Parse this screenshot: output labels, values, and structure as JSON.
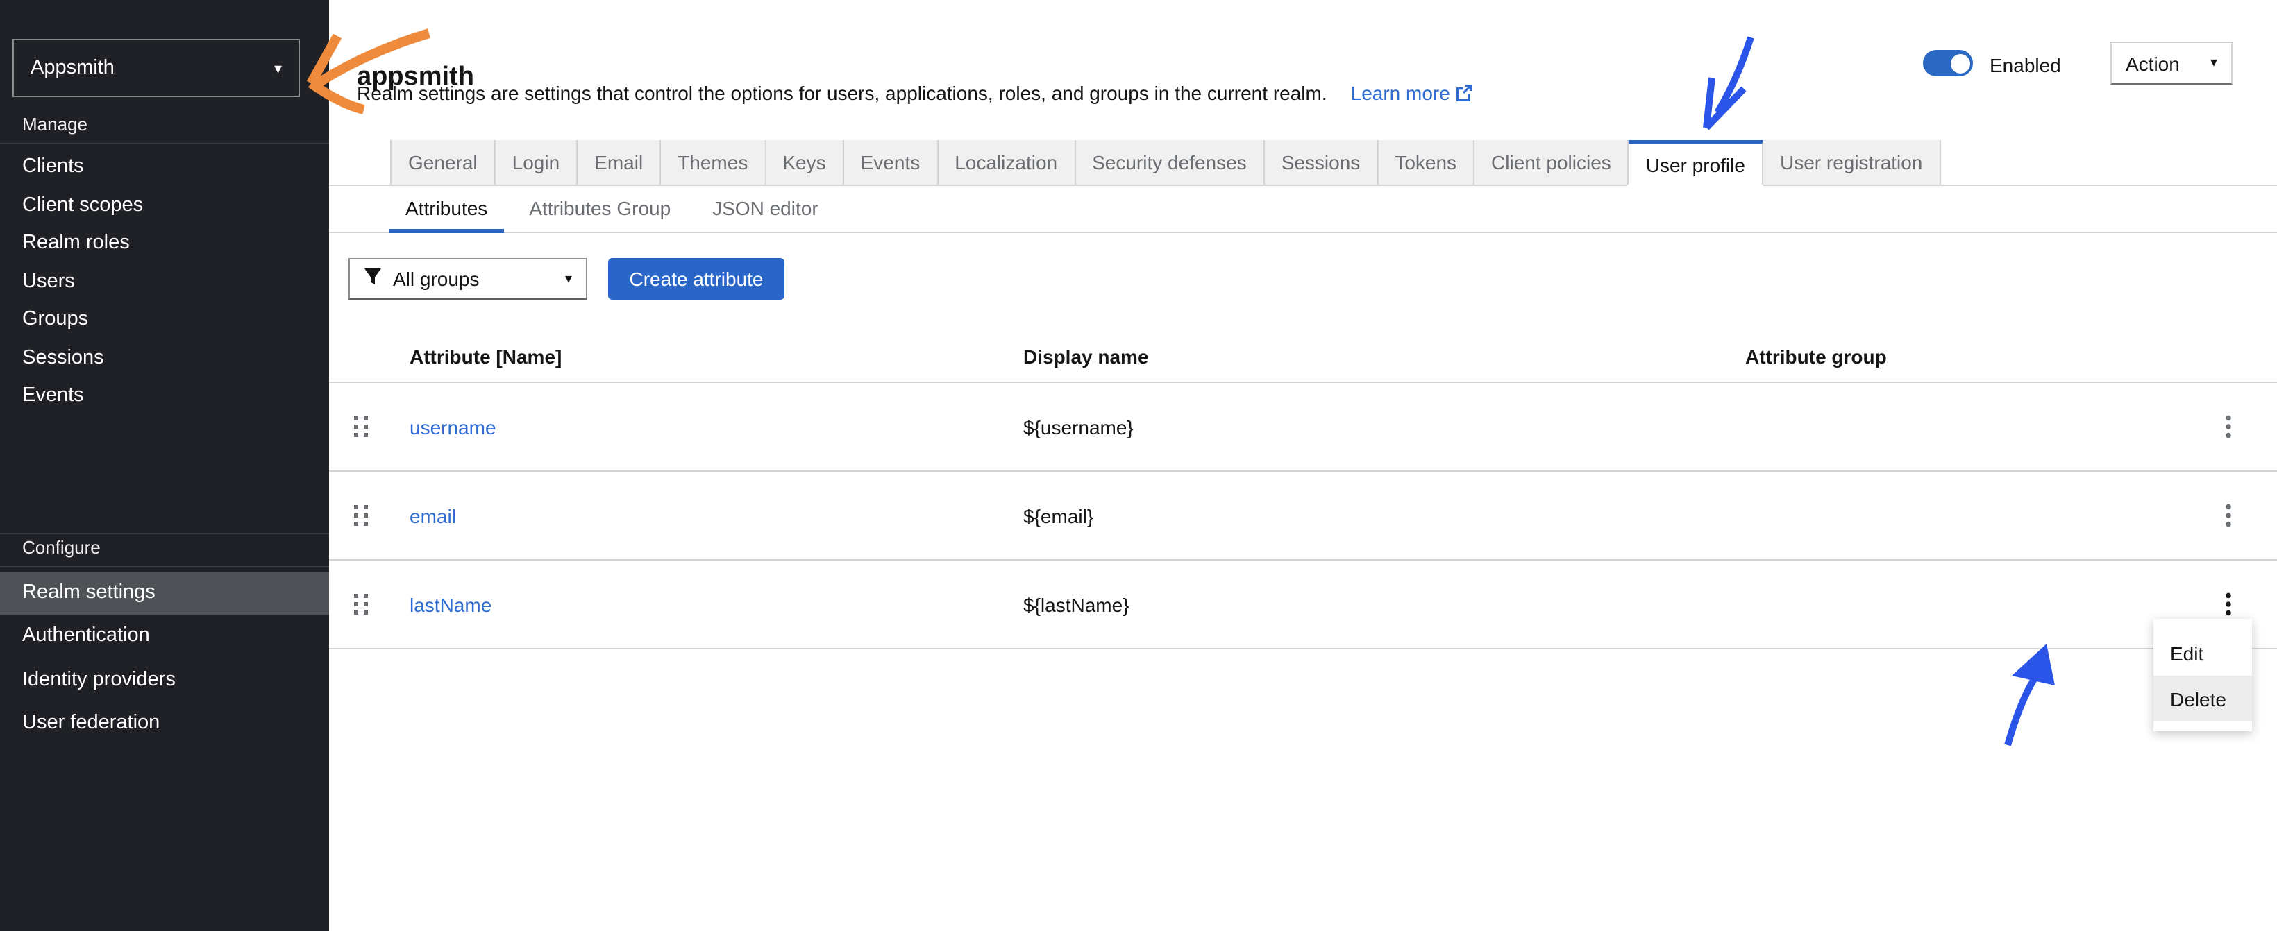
{
  "sidebar": {
    "realm_selector": "Appsmith",
    "sections": [
      {
        "label": "Manage",
        "items": [
          {
            "label": "Clients"
          },
          {
            "label": "Client scopes"
          },
          {
            "label": "Realm roles"
          },
          {
            "label": "Users"
          },
          {
            "label": "Groups"
          },
          {
            "label": "Sessions"
          },
          {
            "label": "Events"
          }
        ]
      },
      {
        "label": "Configure",
        "items": [
          {
            "label": "Realm settings",
            "active": true
          },
          {
            "label": "Authentication"
          },
          {
            "label": "Identity providers"
          },
          {
            "label": "User federation"
          }
        ]
      }
    ]
  },
  "header": {
    "title": "appsmith",
    "description": "Realm settings are settings that control the options for users, applications, roles, and groups in the current realm.",
    "learn_more_label": "Learn more",
    "enabled_label": "Enabled",
    "action_label": "Action"
  },
  "tabs": [
    {
      "label": "General"
    },
    {
      "label": "Login"
    },
    {
      "label": "Email"
    },
    {
      "label": "Themes"
    },
    {
      "label": "Keys"
    },
    {
      "label": "Events"
    },
    {
      "label": "Localization"
    },
    {
      "label": "Security defenses"
    },
    {
      "label": "Sessions"
    },
    {
      "label": "Tokens"
    },
    {
      "label": "Client policies"
    },
    {
      "label": "User profile",
      "active": true
    },
    {
      "label": "User registration"
    }
  ],
  "subtabs": [
    {
      "label": "Attributes",
      "active": true
    },
    {
      "label": "Attributes Group"
    },
    {
      "label": "JSON editor"
    }
  ],
  "toolbar": {
    "filter_value": "All groups",
    "create_button_label": "Create attribute"
  },
  "table": {
    "columns": [
      "Attribute [Name]",
      "Display name",
      "Attribute group"
    ],
    "rows": [
      {
        "name": "username",
        "display_name": "${username}",
        "group": ""
      },
      {
        "name": "email",
        "display_name": "${email}",
        "group": ""
      },
      {
        "name": "lastName",
        "display_name": "${lastName}",
        "group": ""
      }
    ]
  },
  "context_menu": {
    "items": [
      {
        "label": "Edit"
      },
      {
        "label": "Delete",
        "highlighted": true
      }
    ]
  },
  "icons": {
    "caret_down": "▾"
  },
  "colors": {
    "primary_blue": "#2a66c8",
    "link_blue": "#2f6bd0",
    "annotation_blue": "#2b55e8",
    "annotation_orange": "#ee8a3c",
    "sidebar_bg": "#1f2126",
    "sidebar_active_bg": "#4f5257",
    "tab_bg": "#f0f0f0",
    "border_gray": "#d2d2d2"
  }
}
